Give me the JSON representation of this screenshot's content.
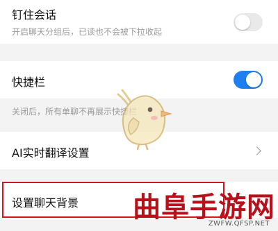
{
  "settings": {
    "pin_chat": {
      "title": "钉住会话",
      "subtitle": "开启聊天分组后，已读也不会被下拉收起",
      "enabled": false
    },
    "shortcut_bar": {
      "title": "快捷栏",
      "enabled": true,
      "note": "关闭后，所有单聊不再展示快捷栏"
    },
    "ai_translate": {
      "title": "AI实时翻译设置"
    },
    "chat_background": {
      "title": "设置聊天背景"
    }
  },
  "watermark": {
    "text": "曲阜手游网",
    "url": "ZWFW.QFSP.NET"
  },
  "colors": {
    "accent": "#1e7ff0",
    "highlight": "#d0161f",
    "watermark": "#b5121b"
  }
}
